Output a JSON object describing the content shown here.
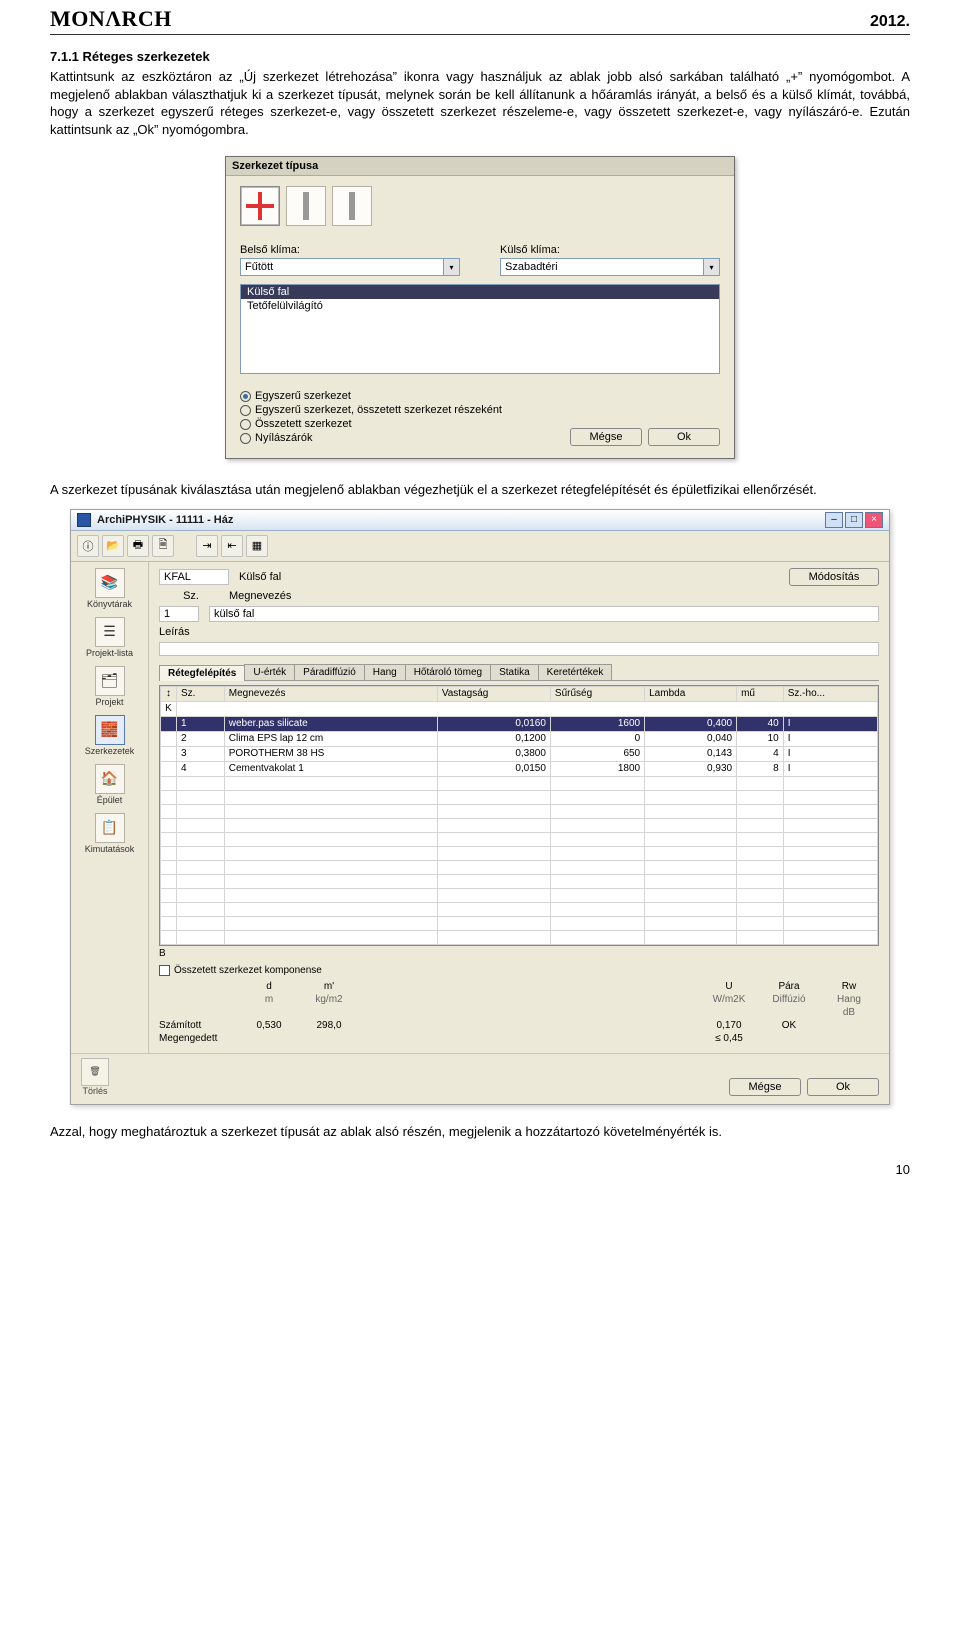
{
  "header": {
    "logo": "MONΛRCH",
    "year": "2012."
  },
  "section_title": "7.1.1 Réteges szerkezetek",
  "paragraph1": "Kattintsunk az eszköztáron az „Új szerkezet létrehozása” ikonra vagy használjuk az ablak jobb alsó sarkában található „+” nyomógombot. A megjelenő ablakban választhatjuk ki a szerkezet típusát, melynek során be kell állítanunk a hőáramlás irányát, a belső és a külső klímát, továbbá, hogy a szerkezet egyszerű réteges szerkezet-e, vagy összetett szerkezet részeleme-e, vagy összetett szerkezet-e, vagy nyílászáró-e. Ezután kattintsunk az „Ok” nyomógombra.",
  "dlg1": {
    "title": "Szerkezet típusa",
    "belso_lbl": "Belső klíma:",
    "kulso_lbl": "Külső klíma:",
    "belso_val": "Fűtött",
    "kulso_val": "Szabadtéri",
    "list_items": [
      "Külső fal",
      "Tetőfelülvilágító"
    ],
    "radios": [
      {
        "label": "Egyszerű szerkezet",
        "checked": true
      },
      {
        "label": "Egyszerű szerkezet, összetett szerkezet részeként",
        "checked": false
      },
      {
        "label": "Összetett szerkezet",
        "checked": false
      },
      {
        "label": "Nyílászárók",
        "checked": false
      }
    ],
    "btn_cancel": "Mégse",
    "btn_ok": "Ok"
  },
  "paragraph2": "A szerkezet típusának kiválasztása után megjelenő ablakban végezhetjük el a szerkezet rétegfelépítését és épületfizikai ellenőrzését.",
  "dlg2": {
    "window_title": "ArchiPHYSIK - 11111 - Ház",
    "sidebar": [
      "Könyvtárak",
      "Projekt-lista",
      "Projekt",
      "Szerkezetek",
      "Épület",
      "Kimutatások"
    ],
    "code": "KFAL",
    "code_name": "Külső fal",
    "modify_btn": "Módosítás",
    "sz_lbl": "Sz.",
    "sz_val": "1",
    "megnev_lbl": "Megnevezés",
    "megnev_val": "külső fal",
    "leiras_lbl": "Leírás",
    "tabs": [
      "Rétegfelépítés",
      "U-érték",
      "Páradiffúzió",
      "Hang",
      "Hőtároló tömeg",
      "Statika",
      "Keretértékek"
    ],
    "table_headers": [
      "Sz.",
      "Megnevezés",
      "Vastagság",
      "Sűrűség",
      "Lambda",
      "mű",
      "Sz.-ho..."
    ],
    "table_rows": [
      {
        "sz": "1",
        "name": "weber.pas silicate",
        "v": "0,0160",
        "s": "1600",
        "l": "0,400",
        "m": "40",
        "sh": "I",
        "sel": true
      },
      {
        "sz": "2",
        "name": "Clima EPS lap 12 cm",
        "v": "0,1200",
        "s": "0",
        "l": "0,040",
        "m": "10",
        "sh": "I"
      },
      {
        "sz": "3",
        "name": "POROTHERM 38 HS",
        "v": "0,3800",
        "s": "650",
        "l": "0,143",
        "m": "4",
        "sh": "I"
      },
      {
        "sz": "4",
        "name": "Cementvakolat 1",
        "v": "0,0150",
        "s": "1800",
        "l": "0,930",
        "m": "8",
        "sh": "I"
      }
    ],
    "chk_label": "Összetett szerkezet komponense",
    "summary_headers": {
      "d": "d",
      "m": "m'",
      "U": "U",
      "para": "Pára",
      "rw": "Rw"
    },
    "summary_units": {
      "d": "m",
      "m": "kg/m2",
      "U": "W/m2K",
      "para": "Diffúzió",
      "rw": "Hang"
    },
    "summary_units2": {
      "rw": "dB"
    },
    "summary_rows": [
      {
        "label": "Számított",
        "d": "0,530",
        "m": "298,0",
        "U": "0,170",
        "para": "OK",
        "rw": ""
      },
      {
        "label": "Megengedett",
        "d": "",
        "m": "",
        "U": "≤ 0,45",
        "para": "",
        "rw": ""
      }
    ],
    "delete_label": "Törlés",
    "btn_cancel": "Mégse",
    "btn_ok": "Ok"
  },
  "paragraph3": "Azzal, hogy meghatároztuk a szerkezet típusát az ablak alsó részén, megjelenik a hozzátartozó követelményérték is.",
  "page_number": "10"
}
